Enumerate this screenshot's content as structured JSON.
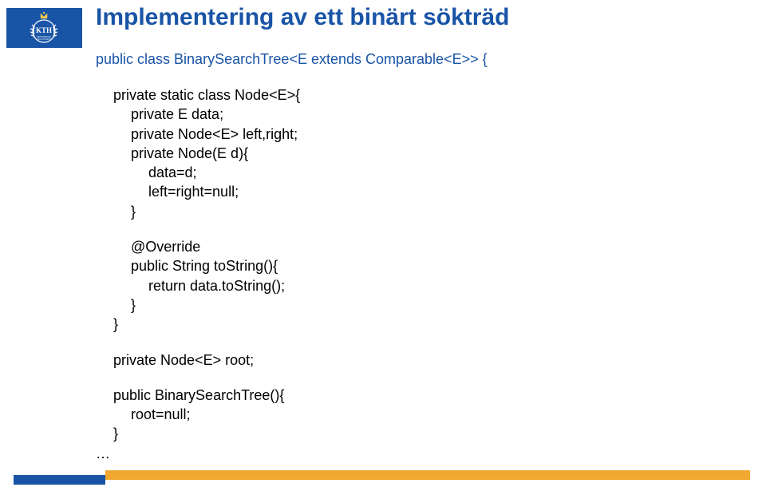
{
  "title": "Implementering av ett binärt sökträd",
  "code": {
    "line1": "public class BinarySearchTree<E extends Comparable<E>> {",
    "line2": "private static class Node<E>{",
    "line3": "private E data;",
    "line4": "private Node<E> left,right;",
    "line5": "private Node(E d){",
    "line6": "data=d;",
    "line7": "left=right=null;",
    "line8": "}",
    "line9": "@Override",
    "line10": "public String toString(){",
    "line11": "return data.toString();",
    "line12": "}",
    "line13": "}",
    "line14": "private Node<E> root;",
    "line15": "public BinarySearchTree(){",
    "line16": "root=null;",
    "line17": "}",
    "line18": "…"
  }
}
